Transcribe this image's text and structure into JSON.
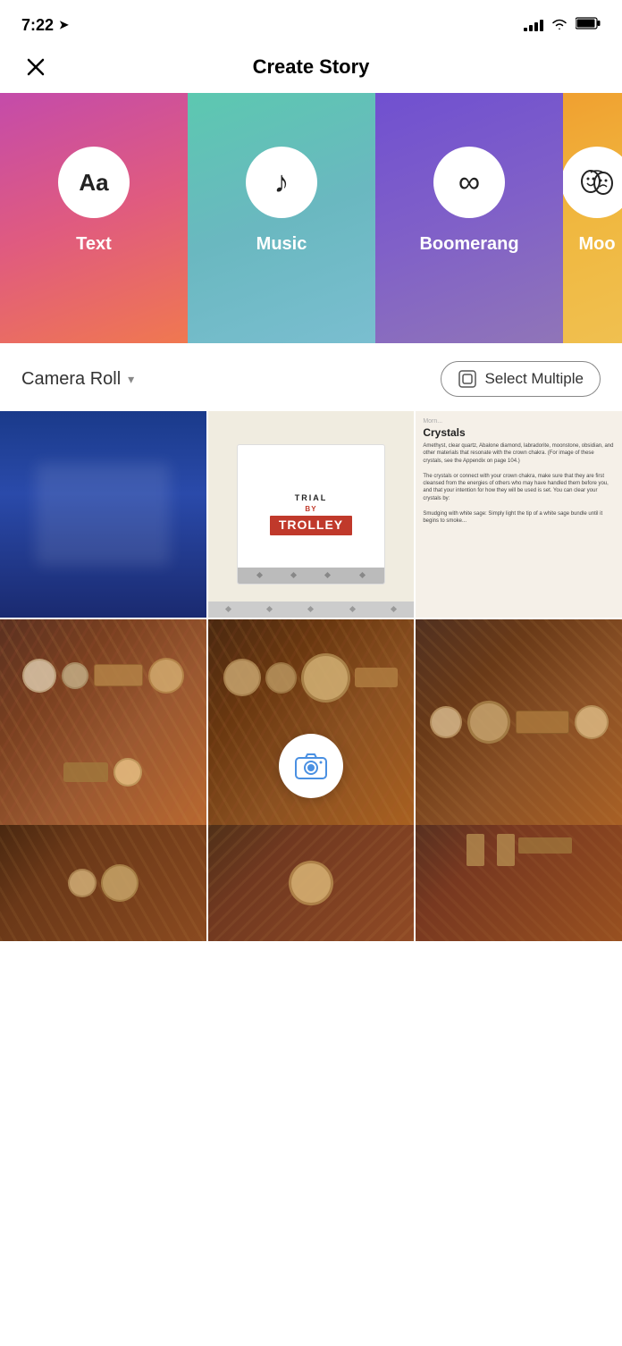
{
  "statusBar": {
    "time": "7:22",
    "locationArrow": "➤"
  },
  "header": {
    "title": "Create Story",
    "closeLabel": "×"
  },
  "storyOptions": [
    {
      "id": "text",
      "label": "Text",
      "icon": "text-icon",
      "iconSymbol": "Aa"
    },
    {
      "id": "music",
      "label": "Music",
      "icon": "music-icon",
      "iconSymbol": "♪"
    },
    {
      "id": "boomerang",
      "label": "Boomerang",
      "icon": "infinity-icon",
      "iconSymbol": "∞"
    },
    {
      "id": "moo",
      "label": "Moo",
      "icon": "masks-icon",
      "iconSymbol": "🎭"
    }
  ],
  "cameraRoll": {
    "label": "Camera Roll",
    "dropdownLabel": "▾",
    "selectMultipleLabel": "Select Multiple"
  },
  "photos": [
    {
      "id": "tv",
      "type": "blue-tv"
    },
    {
      "id": "trolley",
      "type": "trolley"
    },
    {
      "id": "crystals",
      "type": "crystals"
    },
    {
      "id": "food1",
      "type": "food1"
    },
    {
      "id": "food2",
      "type": "food2"
    },
    {
      "id": "food3",
      "type": "food3"
    },
    {
      "id": "food4",
      "type": "food4"
    },
    {
      "id": "food5",
      "type": "food5"
    },
    {
      "id": "food6",
      "type": "food6"
    }
  ],
  "cameraButton": {
    "label": "Take Photo"
  }
}
